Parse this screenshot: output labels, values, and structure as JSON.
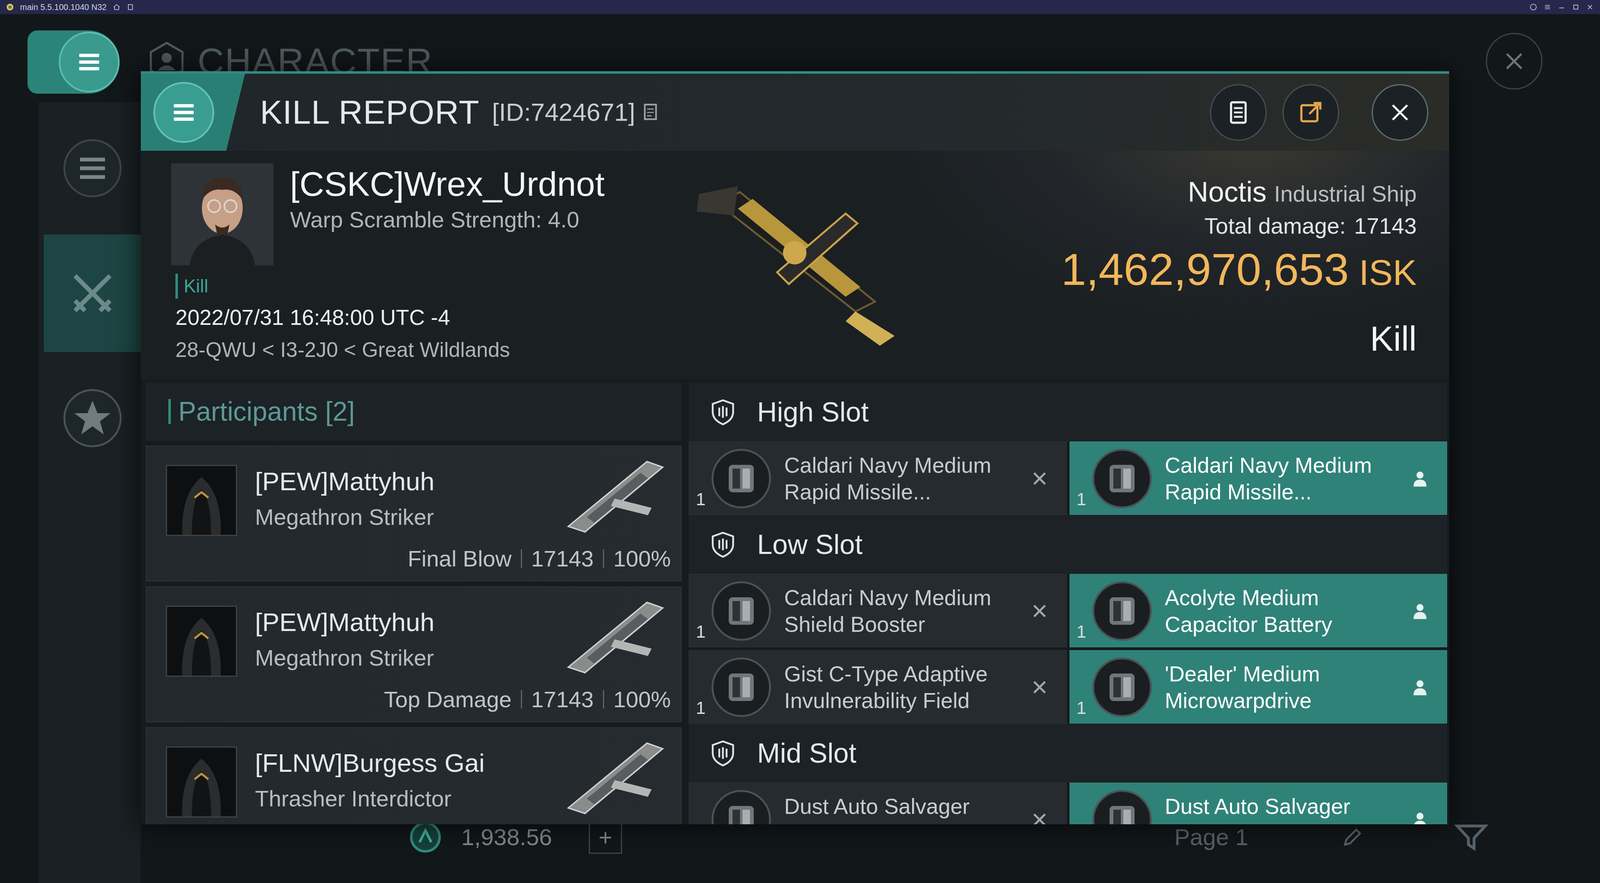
{
  "window": {
    "title": "main 5.5.100.1040 N32"
  },
  "sidebar": {
    "items": [
      {
        "selected": false
      },
      {
        "selected": true
      },
      {
        "selected": false
      }
    ]
  },
  "background": {
    "header": "CHARACTER",
    "balance": "1,938.56",
    "add": "+",
    "page": "Page 1"
  },
  "report": {
    "title": "KILL REPORT",
    "id": "[ID:7424671]"
  },
  "victim": {
    "name": "[CSKC]Wrex_Urdnot",
    "scramble": "Warp Scramble Strength: 4.0",
    "tag": "Kill",
    "time": "2022/07/31 16:48:00 UTC -4",
    "location": "28-QWU < I3-2J0 < Great Wildlands"
  },
  "ship": {
    "name": "Noctis",
    "class": "Industrial Ship",
    "damage_label": "Total damage:",
    "damage": "17143",
    "value": "1,462,970,653",
    "currency": "ISK",
    "result": "Kill"
  },
  "participants": {
    "title": "Participants",
    "count": "[2]",
    "items": [
      {
        "name": "[PEW]Mattyhuh",
        "ship": "Megathron Striker",
        "role": "Final Blow",
        "damage": "17143",
        "share": "100%"
      },
      {
        "name": "[PEW]Mattyhuh",
        "ship": "Megathron Striker",
        "role": "Top Damage",
        "damage": "17143",
        "share": "100%"
      },
      {
        "name": "[FLNW]Burgess Gai",
        "ship": "Thrasher Interdictor"
      }
    ]
  },
  "slots": [
    {
      "title": "High Slot",
      "items": [
        {
          "qty": "1",
          "name": "Caldari Navy Medium Rapid Missile...",
          "dropped": false
        },
        {
          "qty": "1",
          "name": "Caldari Navy Medium Rapid Missile...",
          "dropped": true
        }
      ]
    },
    {
      "title": "Low Slot",
      "items": [
        {
          "qty": "1",
          "name": "Caldari Navy Medium Shield Booster",
          "dropped": false
        },
        {
          "qty": "1",
          "name": "Acolyte Medium Capacitor Battery",
          "dropped": true
        },
        {
          "qty": "1",
          "name": "Gist C-Type Adaptive Invulnerability Field",
          "dropped": false
        },
        {
          "qty": "1",
          "name": "'Dealer' Medium Microwarpdrive",
          "dropped": true
        }
      ]
    },
    {
      "title": "Mid Slot",
      "items": [
        {
          "name": "Dust Auto Salvager",
          "dropped": false
        },
        {
          "name": "Dust Auto Salvager",
          "dropped": true
        }
      ]
    }
  ]
}
